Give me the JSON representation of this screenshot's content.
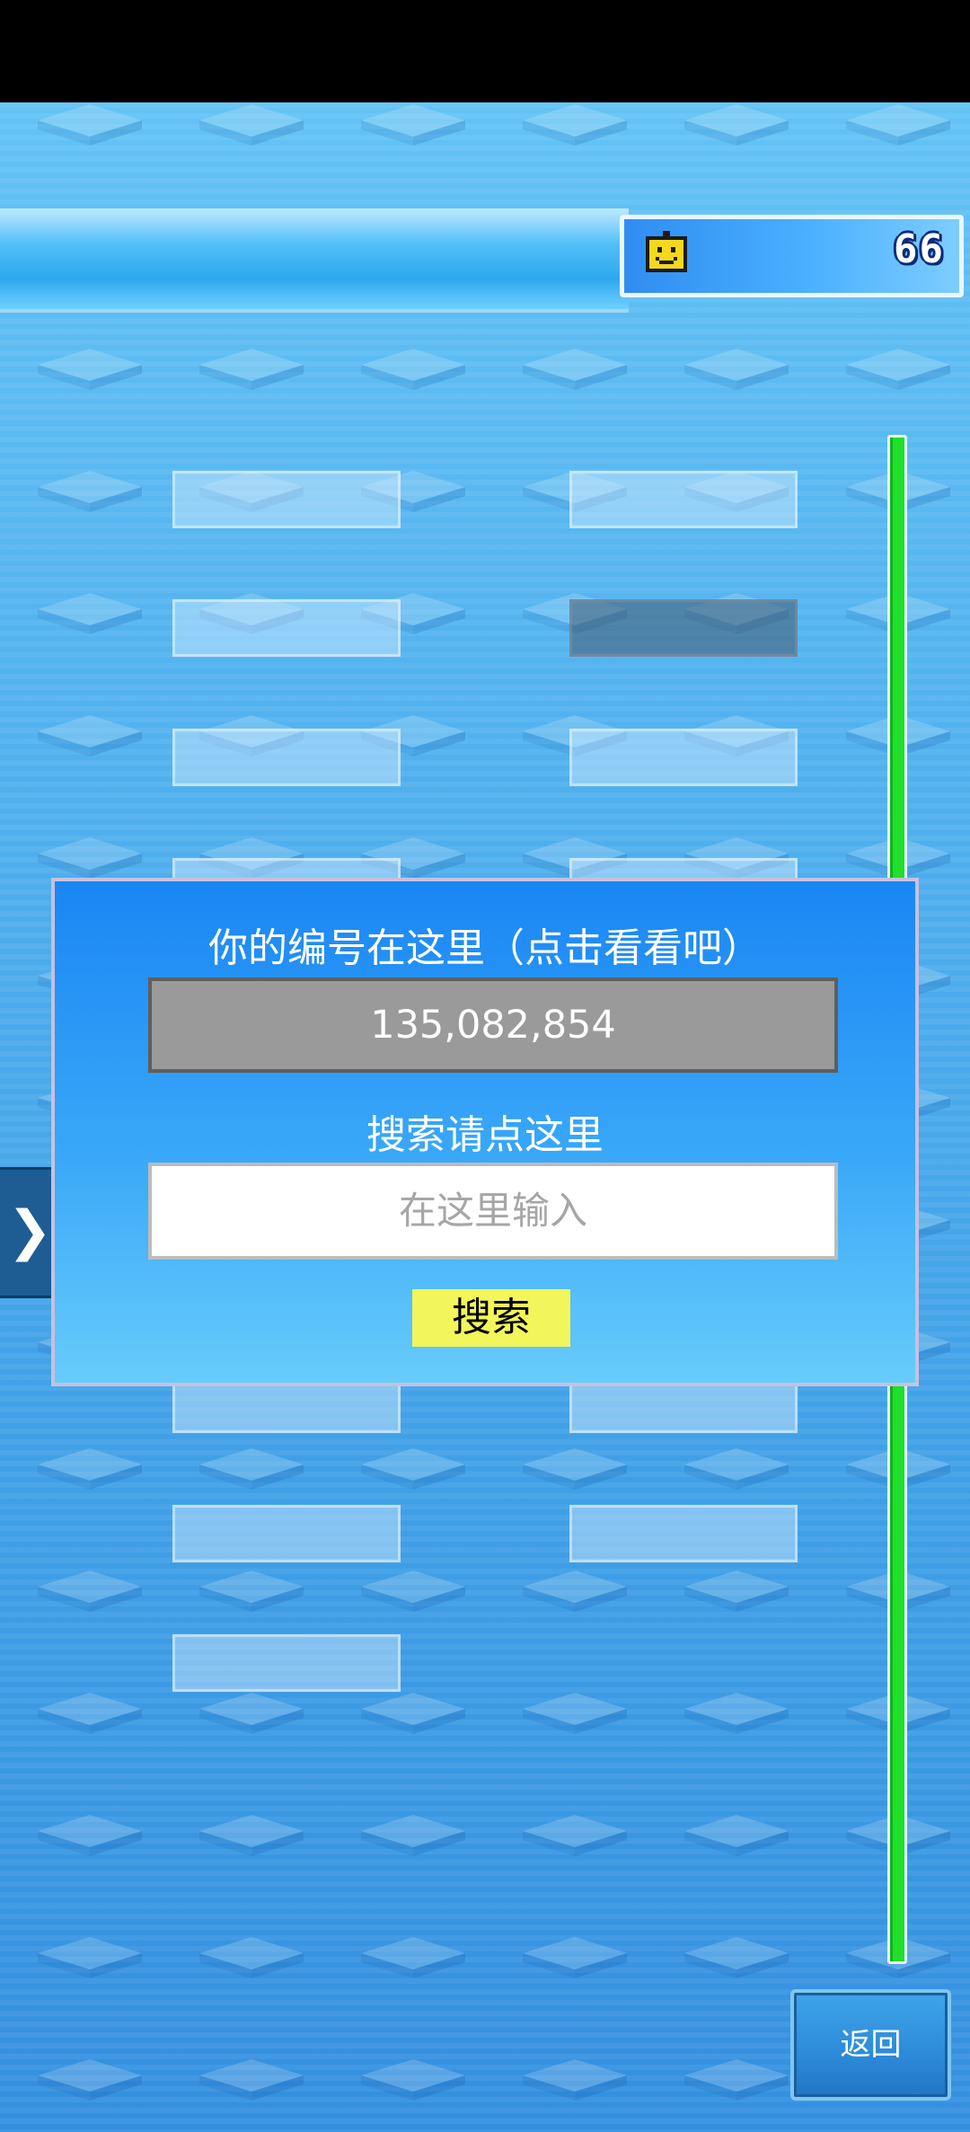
{
  "score": {
    "icon": "smiley-icon",
    "value": "66"
  },
  "id_dialog": {
    "title": "你的编号在这里（点击看看吧）",
    "player_id": "135,082,854",
    "search_label": "搜索请点这里",
    "search_placeholder": "在这里输入",
    "search_button": "搜索"
  },
  "side_tab": {
    "icon": "chevron-right-icon",
    "glyph": "❯"
  },
  "back_button": "返回",
  "colors": {
    "scrollbar": "#1fe02a",
    "search_button": "#f2f65a",
    "dialog_top": "#1a86f4",
    "dialog_bottom": "#67ccfb"
  }
}
